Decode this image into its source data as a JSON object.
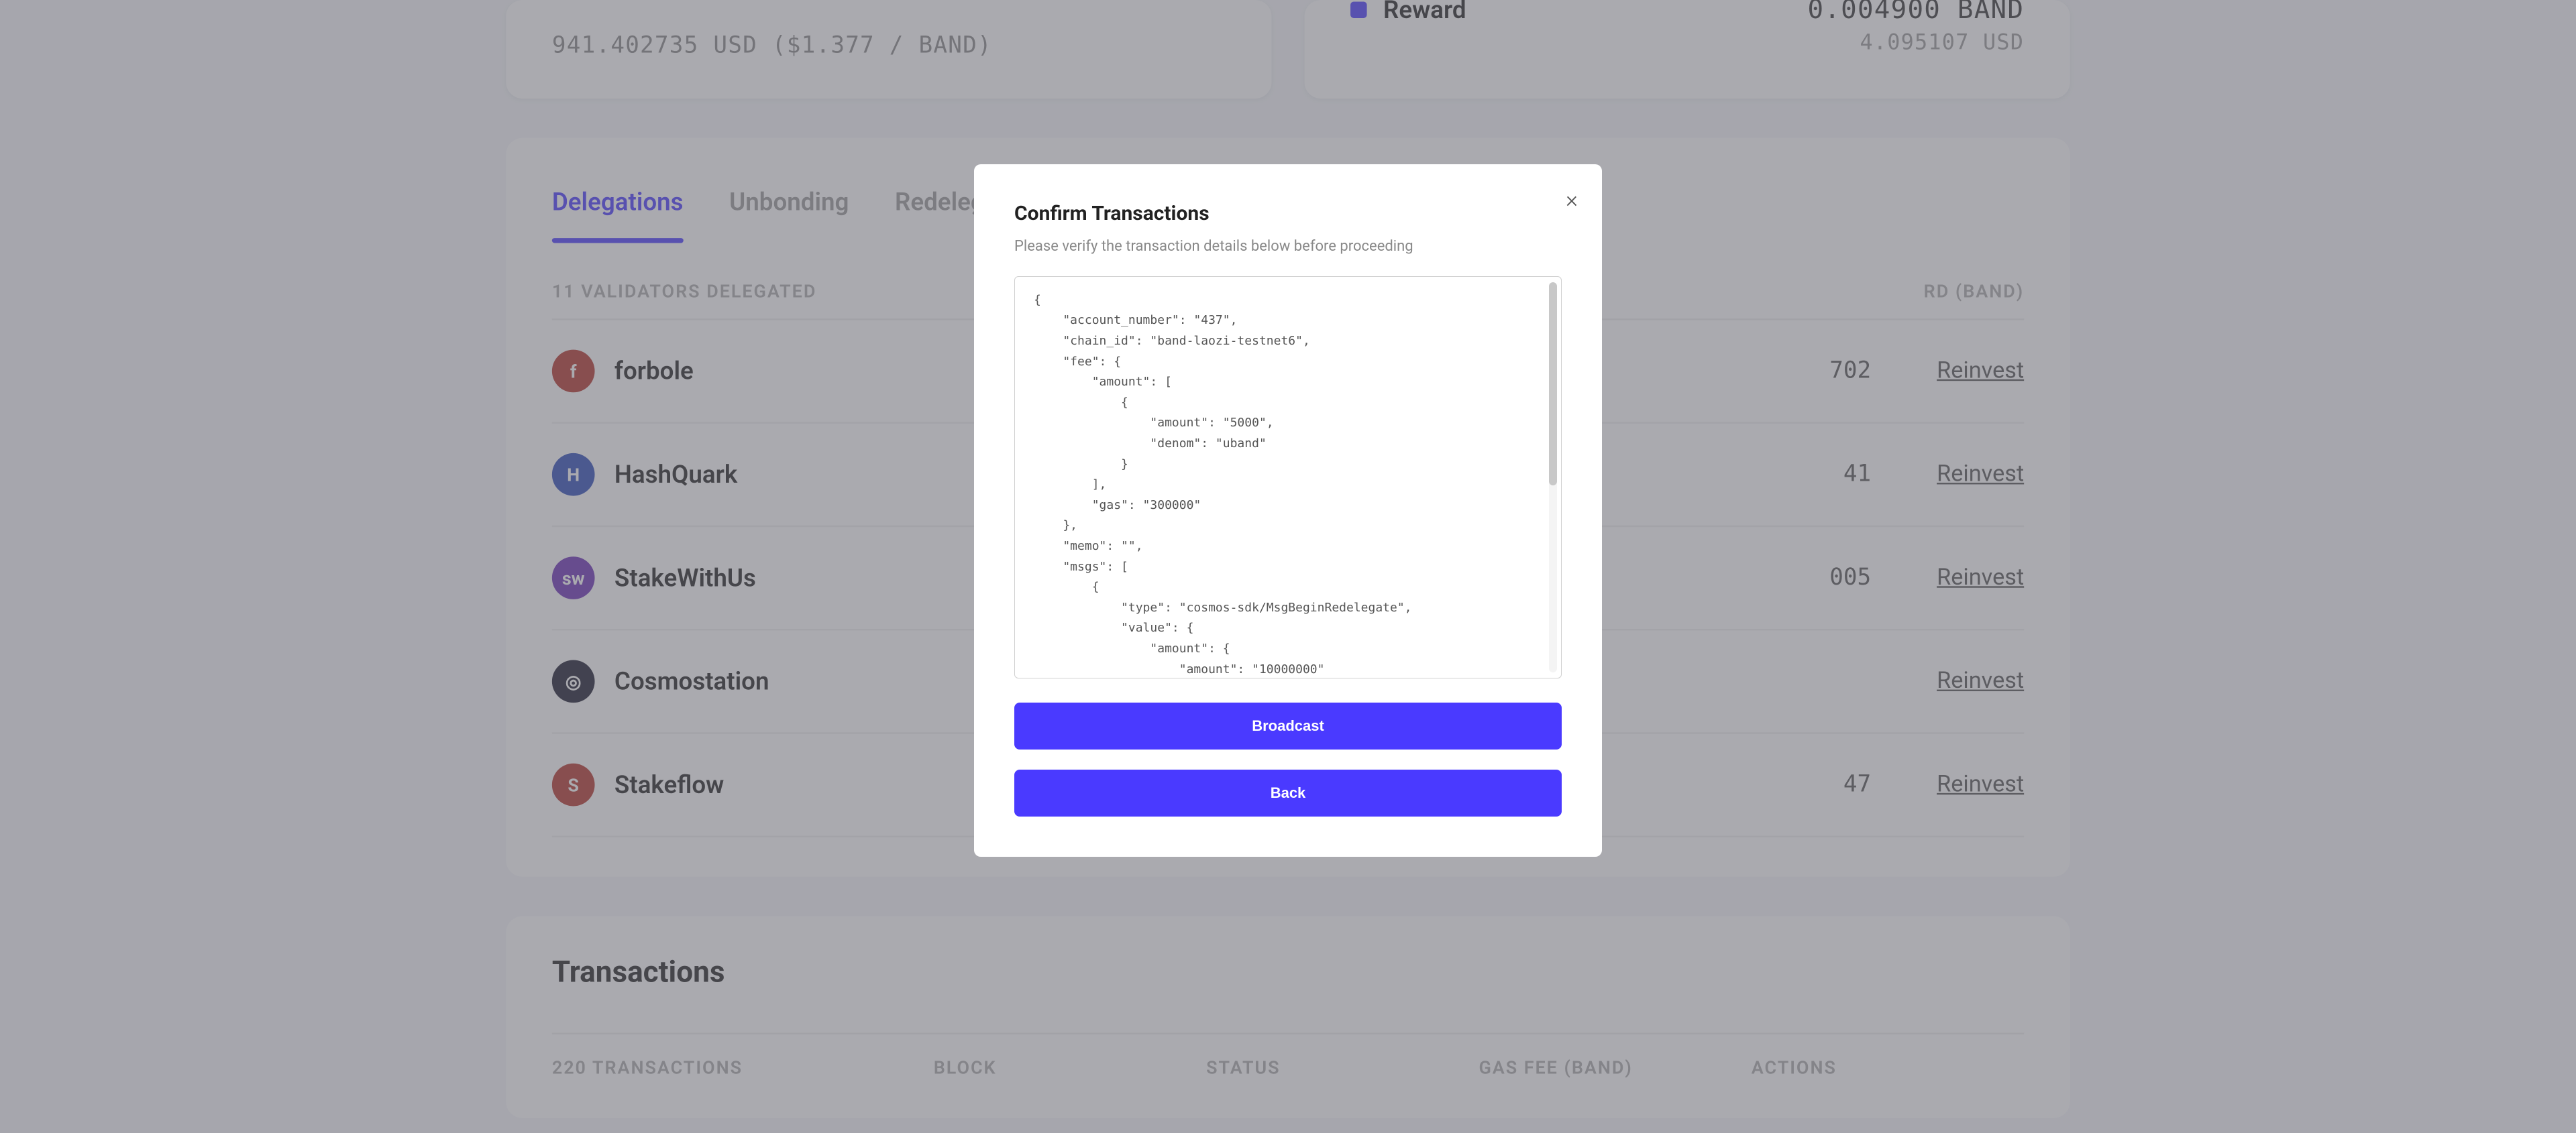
{
  "colors": {
    "accent": "#4a3aff"
  },
  "balance": {
    "usd_line": "941.402735  USD ($1.377 / BAND)"
  },
  "reward_card": {
    "label": "Reward",
    "amount_partial": "0.004900 BAND",
    "usd": "4.095107 USD"
  },
  "delegations": {
    "tabs": [
      {
        "label": "Delegations",
        "active": true
      },
      {
        "label": "Unbonding",
        "active": false
      },
      {
        "label": "Redelegate",
        "active": false
      }
    ],
    "count_prefix": "11",
    "count_suffix": " VALIDATORS DELEGATED",
    "reward_col": "RD (BAND)",
    "rows": [
      {
        "name": "forbole",
        "icon_bg": "#b3342b",
        "icon_txt": "f",
        "reward": "702",
        "action": "Reinvest"
      },
      {
        "name": "HashQuark",
        "icon_bg": "#2e4db8",
        "icon_txt": "H",
        "reward": "41",
        "action": "Reinvest"
      },
      {
        "name": "StakeWithUs",
        "icon_bg": "#6b2fb5",
        "icon_txt": "sw",
        "reward": "005",
        "action": "Reinvest"
      },
      {
        "name": "Cosmostation",
        "icon_bg": "#1a1a2e",
        "icon_txt": "◎",
        "reward": "",
        "action": "Reinvest"
      },
      {
        "name": "Stakeflow",
        "icon_bg": "#b3342b",
        "icon_txt": "S",
        "reward": "47",
        "action": "Reinvest"
      }
    ]
  },
  "transactions": {
    "title": "Transactions",
    "count_prefix": "220",
    "count_suffix": " TRANSACTIONS",
    "cols": [
      "BLOCK",
      "STATUS",
      "GAS FEE (BAND)",
      "ACTIONS"
    ]
  },
  "modal": {
    "title": "Confirm Transactions",
    "subtitle": "Please verify the transaction details below before proceeding",
    "json_text": "{\n    \"account_number\": \"437\",\n    \"chain_id\": \"band-laozi-testnet6\",\n    \"fee\": {\n        \"amount\": [\n            {\n                \"amount\": \"5000\",\n                \"denom\": \"uband\"\n            }\n        ],\n        \"gas\": \"300000\"\n    },\n    \"memo\": \"\",\n    \"msgs\": [\n        {\n            \"type\": \"cosmos-sdk/MsgBeginRedelegate\",\n            \"value\": {\n                \"amount\": {\n                    \"amount\": \"10000000\"",
    "broadcast": "Broadcast",
    "back": "Back"
  }
}
